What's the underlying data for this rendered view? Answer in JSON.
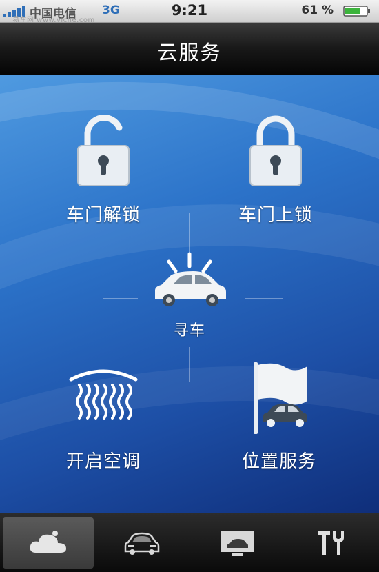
{
  "status_bar": {
    "carrier": "中国电信",
    "network": "3G",
    "time": "9:21",
    "battery": "61 %",
    "watermark": "易车网 www.yiche.com"
  },
  "header": {
    "title": "云服务"
  },
  "actions": [
    {
      "label": "车门解锁",
      "icon": "unlocked-padlock-icon"
    },
    {
      "label": "车门上锁",
      "icon": "locked-padlock-icon"
    },
    {
      "label": "寻车",
      "icon": "car-honk-icon"
    },
    {
      "label": "开启空调",
      "icon": "windshield-defrost-icon"
    },
    {
      "label": "位置服务",
      "icon": "flag-car-icon"
    }
  ],
  "tabs": [
    {
      "icon": "cloud-icon",
      "active": true
    },
    {
      "icon": "car-icon",
      "active": false
    },
    {
      "icon": "monitor-car-icon",
      "active": false
    },
    {
      "icon": "tools-icon",
      "active": false
    }
  ],
  "colors": {
    "accent": "#2f6fb8",
    "panel_top": "#4f9ae0",
    "panel_bottom": "#0f2e7a"
  }
}
